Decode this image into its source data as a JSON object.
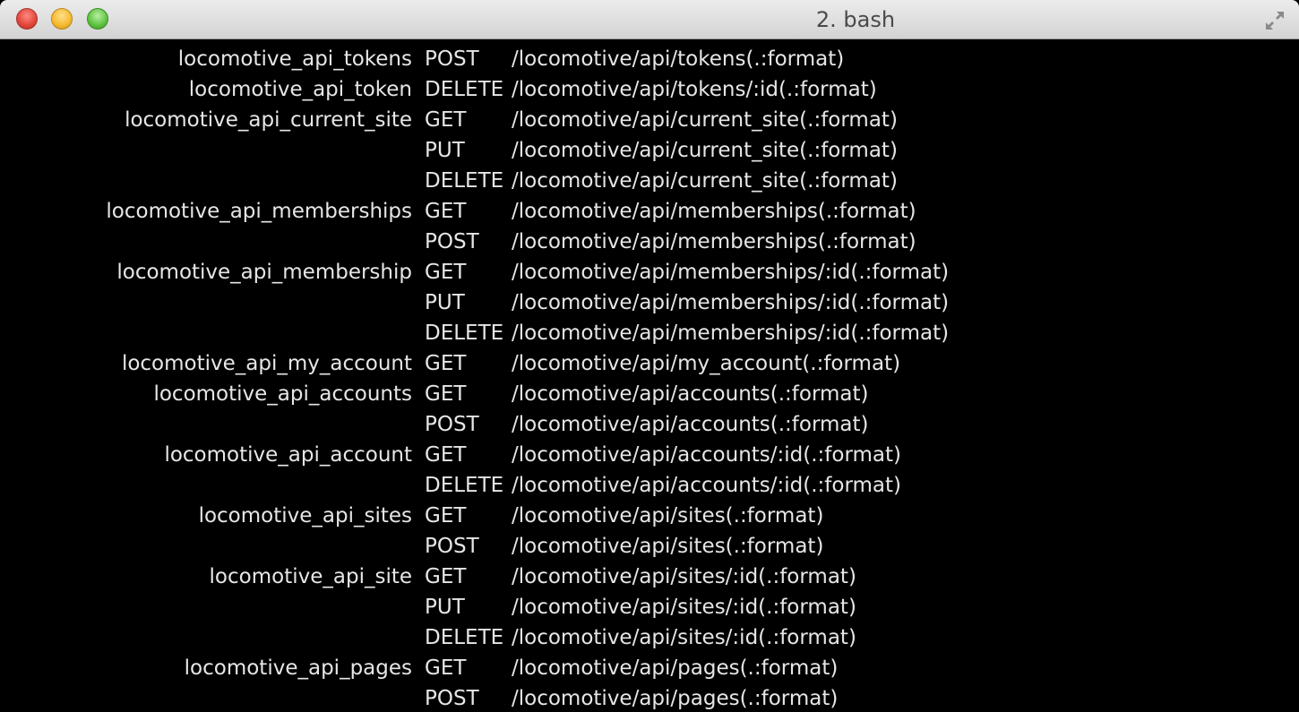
{
  "window": {
    "title": "2. bash"
  },
  "routes": [
    {
      "name": "locomotive_api_tokens",
      "verb": "POST",
      "path": "/locomotive/api/tokens(.:format)"
    },
    {
      "name": "locomotive_api_token",
      "verb": "DELETE",
      "path": "/locomotive/api/tokens/:id(.:format)"
    },
    {
      "name": "locomotive_api_current_site",
      "verb": "GET",
      "path": "/locomotive/api/current_site(.:format)"
    },
    {
      "name": "",
      "verb": "PUT",
      "path": "/locomotive/api/current_site(.:format)"
    },
    {
      "name": "",
      "verb": "DELETE",
      "path": "/locomotive/api/current_site(.:format)"
    },
    {
      "name": "locomotive_api_memberships",
      "verb": "GET",
      "path": "/locomotive/api/memberships(.:format)"
    },
    {
      "name": "",
      "verb": "POST",
      "path": "/locomotive/api/memberships(.:format)"
    },
    {
      "name": "locomotive_api_membership",
      "verb": "GET",
      "path": "/locomotive/api/memberships/:id(.:format)"
    },
    {
      "name": "",
      "verb": "PUT",
      "path": "/locomotive/api/memberships/:id(.:format)"
    },
    {
      "name": "",
      "verb": "DELETE",
      "path": "/locomotive/api/memberships/:id(.:format)"
    },
    {
      "name": "locomotive_api_my_account",
      "verb": "GET",
      "path": "/locomotive/api/my_account(.:format)"
    },
    {
      "name": "locomotive_api_accounts",
      "verb": "GET",
      "path": "/locomotive/api/accounts(.:format)"
    },
    {
      "name": "",
      "verb": "POST",
      "path": "/locomotive/api/accounts(.:format)"
    },
    {
      "name": "locomotive_api_account",
      "verb": "GET",
      "path": "/locomotive/api/accounts/:id(.:format)"
    },
    {
      "name": "",
      "verb": "DELETE",
      "path": "/locomotive/api/accounts/:id(.:format)"
    },
    {
      "name": "locomotive_api_sites",
      "verb": "GET",
      "path": "/locomotive/api/sites(.:format)"
    },
    {
      "name": "",
      "verb": "POST",
      "path": "/locomotive/api/sites(.:format)"
    },
    {
      "name": "locomotive_api_site",
      "verb": "GET",
      "path": "/locomotive/api/sites/:id(.:format)"
    },
    {
      "name": "",
      "verb": "PUT",
      "path": "/locomotive/api/sites/:id(.:format)"
    },
    {
      "name": "",
      "verb": "DELETE",
      "path": "/locomotive/api/sites/:id(.:format)"
    },
    {
      "name": "locomotive_api_pages",
      "verb": "GET",
      "path": "/locomotive/api/pages(.:format)"
    },
    {
      "name": "",
      "verb": "POST",
      "path": "/locomotive/api/pages(.:format)"
    }
  ]
}
